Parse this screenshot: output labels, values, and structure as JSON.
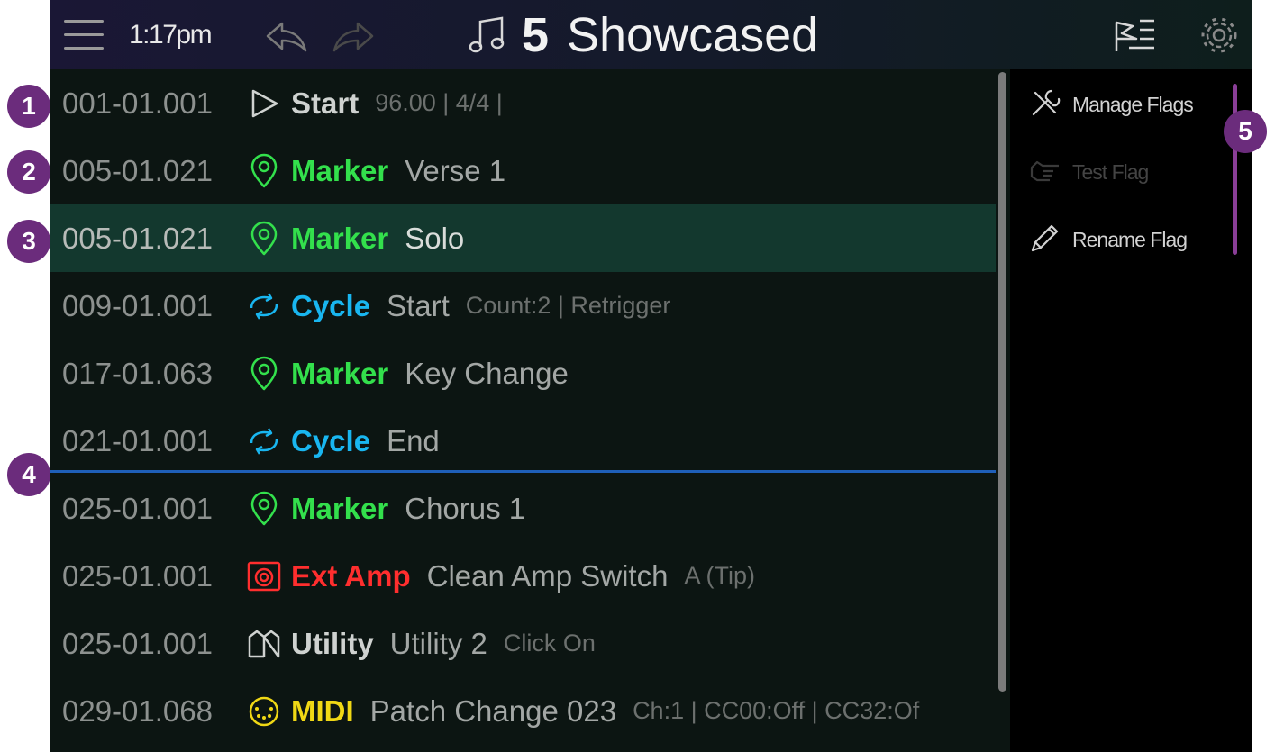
{
  "header": {
    "time": "1:17pm",
    "song_number": "5",
    "song_title": "Showcased",
    "icons": [
      "menu-icon",
      "undo-icon",
      "redo-icon",
      "music-note-icon",
      "flags-list-icon",
      "gear-icon"
    ]
  },
  "colors": {
    "marker": "#33e04c",
    "cycle": "#19b6f0",
    "ext_amp": "#ff2e2e",
    "utility": "#cfd2d0",
    "midi": "#f0d815",
    "start": "#cfd2d0",
    "playhead": "#1f5fb8",
    "callout": "#6b2c7c",
    "selected_row": "#13382e"
  },
  "flags": [
    {
      "position": "001-01.001",
      "type": "Start",
      "name": "",
      "detail": "96.00 | 4/4 |",
      "icon": "play-icon",
      "color_key": "start",
      "selected": false
    },
    {
      "position": "005-01.021",
      "type": "Marker",
      "name": "Verse 1",
      "detail": "",
      "icon": "map-pin-icon",
      "color_key": "marker",
      "selected": false
    },
    {
      "position": "005-01.021",
      "type": "Marker",
      "name": "Solo",
      "detail": "",
      "icon": "map-pin-icon",
      "color_key": "marker",
      "selected": true
    },
    {
      "position": "009-01.001",
      "type": "Cycle",
      "name": "Start",
      "detail": "Count:2 | Retrigger",
      "icon": "cycle-icon",
      "color_key": "cycle",
      "selected": false
    },
    {
      "position": "017-01.063",
      "type": "Marker",
      "name": "Key Change",
      "detail": "",
      "icon": "map-pin-icon",
      "color_key": "marker",
      "selected": false
    },
    {
      "position": "021-01.001",
      "type": "Cycle",
      "name": "End",
      "detail": "",
      "icon": "cycle-icon",
      "color_key": "cycle",
      "selected": false
    },
    {
      "position": "025-01.001",
      "type": "Marker",
      "name": "Chorus 1",
      "detail": "",
      "icon": "map-pin-icon",
      "color_key": "marker",
      "selected": false
    },
    {
      "position": "025-01.001",
      "type": "Ext Amp",
      "name": "Clean Amp Switch",
      "detail": "A (Tip)",
      "icon": "amp-icon",
      "color_key": "ext_amp",
      "selected": false
    },
    {
      "position": "025-01.001",
      "type": "Utility",
      "name": "Utility 2",
      "detail": "Click On",
      "icon": "utility-icon",
      "color_key": "utility",
      "selected": false
    },
    {
      "position": "029-01.068",
      "type": "MIDI",
      "name": "Patch Change 023",
      "detail": "Ch:1 | CC00:Off | CC32:Of",
      "icon": "midi-icon",
      "color_key": "midi",
      "selected": false
    }
  ],
  "menu": [
    {
      "label": "Manage Flags",
      "icon": "tools-icon",
      "disabled": false
    },
    {
      "label": "Test Flag",
      "icon": "pointing-hand-icon",
      "disabled": true
    },
    {
      "label": "Rename Flag",
      "icon": "pencil-icon",
      "disabled": false
    }
  ],
  "callouts": [
    "1",
    "2",
    "3",
    "4",
    "5"
  ]
}
